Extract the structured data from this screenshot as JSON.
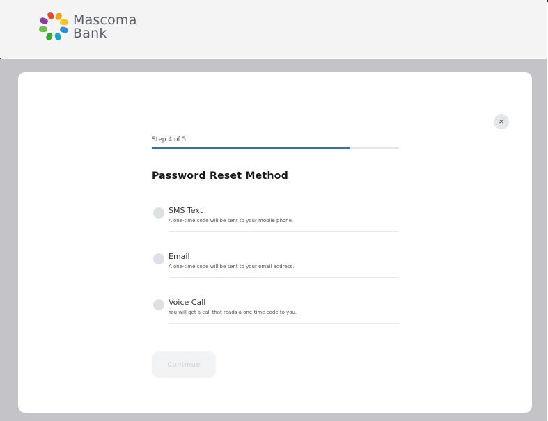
{
  "header": {
    "logo": {
      "line1": "Mascoma",
      "line2": "Bank"
    }
  },
  "dialog": {
    "close_icon": "×",
    "step_label": "Step 4 of 5",
    "progress_fraction": 0.8,
    "title": "Password Reset Method",
    "options": [
      {
        "label": "SMS Text",
        "description": "A one-time code will be sent to your mobile phone."
      },
      {
        "label": "Email",
        "description": "A one-time code will be sent to your email address."
      },
      {
        "label": "Voice Call",
        "description": "You will get a call that reads a one-time code to you."
      }
    ],
    "continue_label": "Continue"
  },
  "colors": {
    "accent": "#2a73a8",
    "backdrop": "#c4c4c8",
    "radio": "#dde1e5"
  }
}
